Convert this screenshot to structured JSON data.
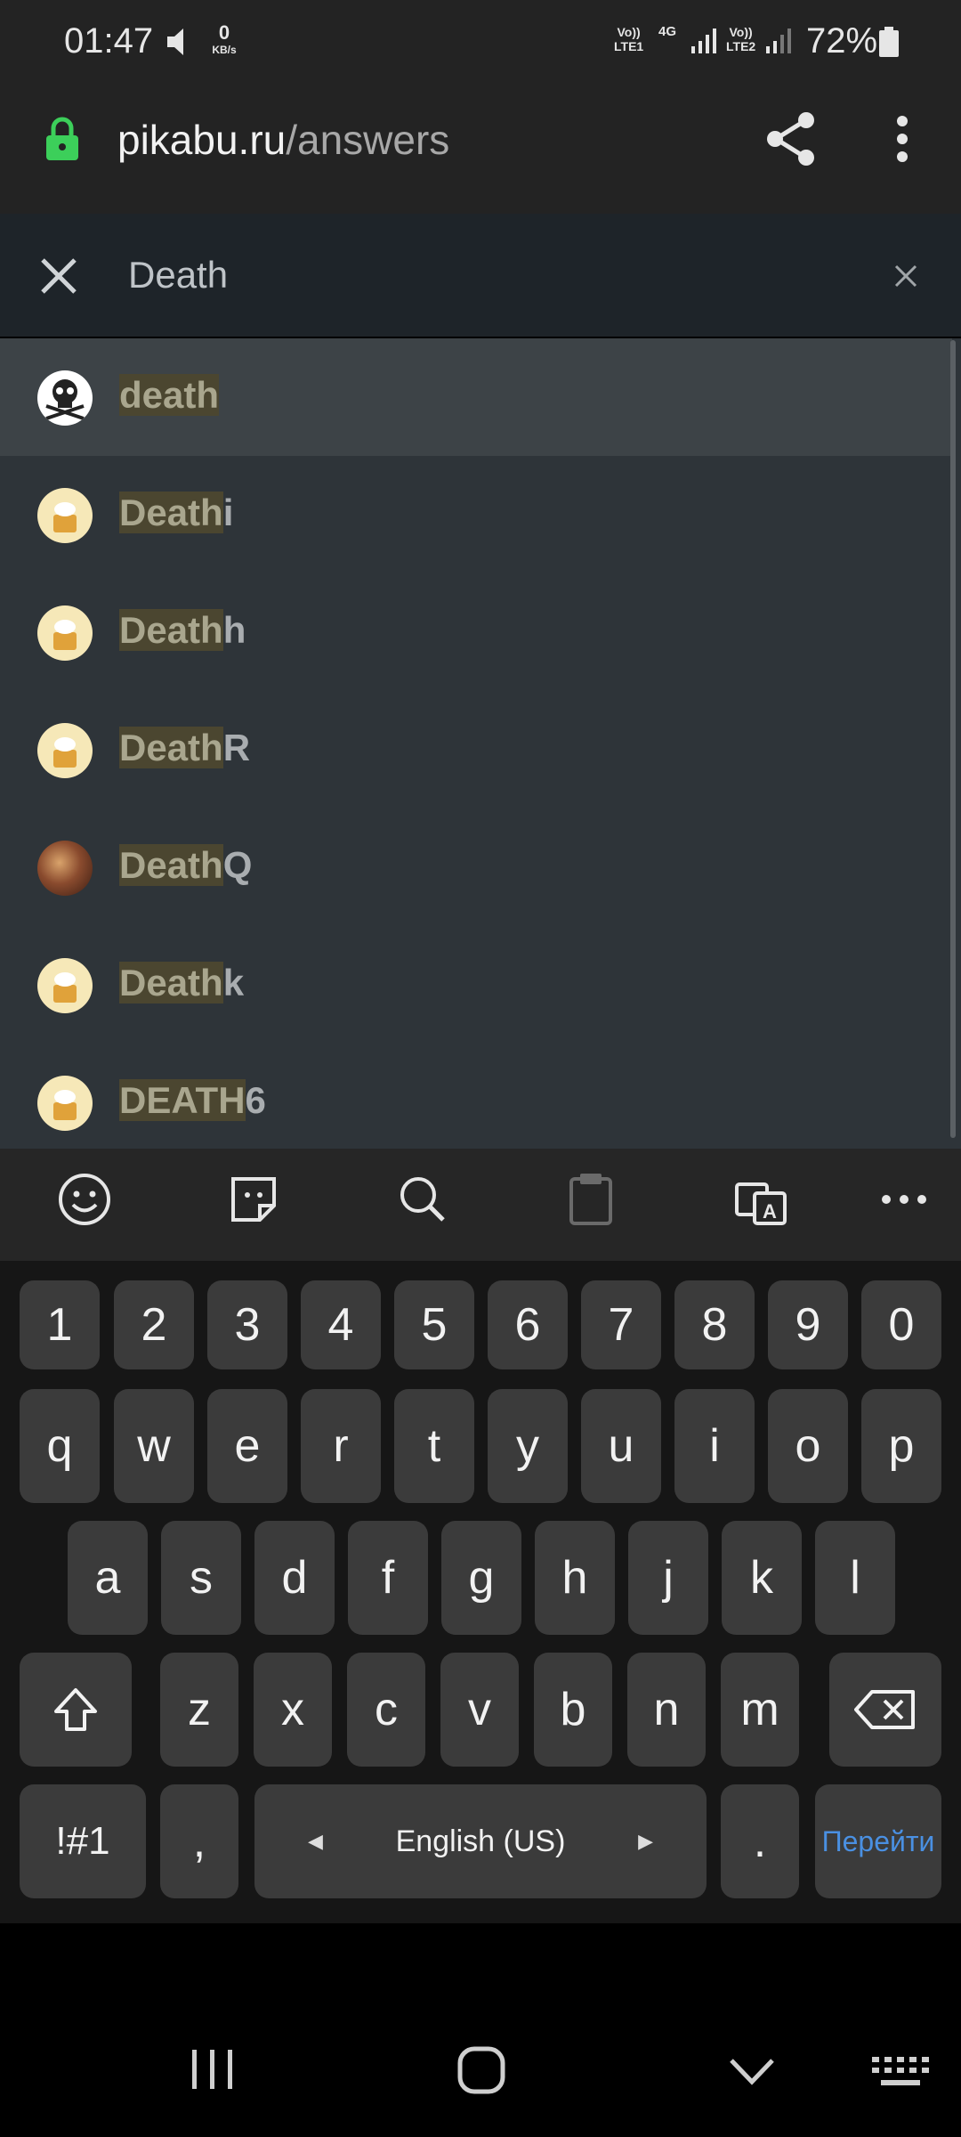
{
  "status_bar": {
    "time": "01:47",
    "speed_value": "0",
    "speed_unit": "KB/s",
    "sim1_top": "Vo))",
    "sim1_bottom": "LTE1",
    "sim1_net": "4G",
    "sim2_top": "Vo))",
    "sim2_bottom": "LTE2",
    "battery": "72%"
  },
  "browser": {
    "url_domain": "pikabu.ru",
    "url_path": "/answers"
  },
  "search": {
    "value": "Death"
  },
  "results": [
    {
      "match": "death",
      "rest": "",
      "avatar": "skull-icon",
      "selected": true
    },
    {
      "match": "Death",
      "rest": "i",
      "avatar": "cake-avatar"
    },
    {
      "match": "Death",
      "rest": "h",
      "avatar": "cake-avatar"
    },
    {
      "match": "Death",
      "rest": "R",
      "avatar": "cake-avatar"
    },
    {
      "match": "Death",
      "rest": "Q",
      "avatar": "photo-avatar"
    },
    {
      "match": "Death",
      "rest": "k",
      "avatar": "cake-avatar"
    },
    {
      "match": "DEATH",
      "rest": "6",
      "avatar": "cake-avatar"
    }
  ],
  "keyboard": {
    "numbers": [
      "1",
      "2",
      "3",
      "4",
      "5",
      "6",
      "7",
      "8",
      "9",
      "0"
    ],
    "row1": [
      "q",
      "w",
      "e",
      "r",
      "t",
      "y",
      "u",
      "i",
      "o",
      "p"
    ],
    "row2": [
      "a",
      "s",
      "d",
      "f",
      "g",
      "h",
      "j",
      "k",
      "l"
    ],
    "row3": [
      "z",
      "x",
      "c",
      "v",
      "b",
      "n",
      "m"
    ],
    "symbols_key": "!#1",
    "comma_key": ",",
    "space_label": "English (US)",
    "period_key": ".",
    "go_key": "Перейти",
    "go_color": "#4a90e2"
  }
}
